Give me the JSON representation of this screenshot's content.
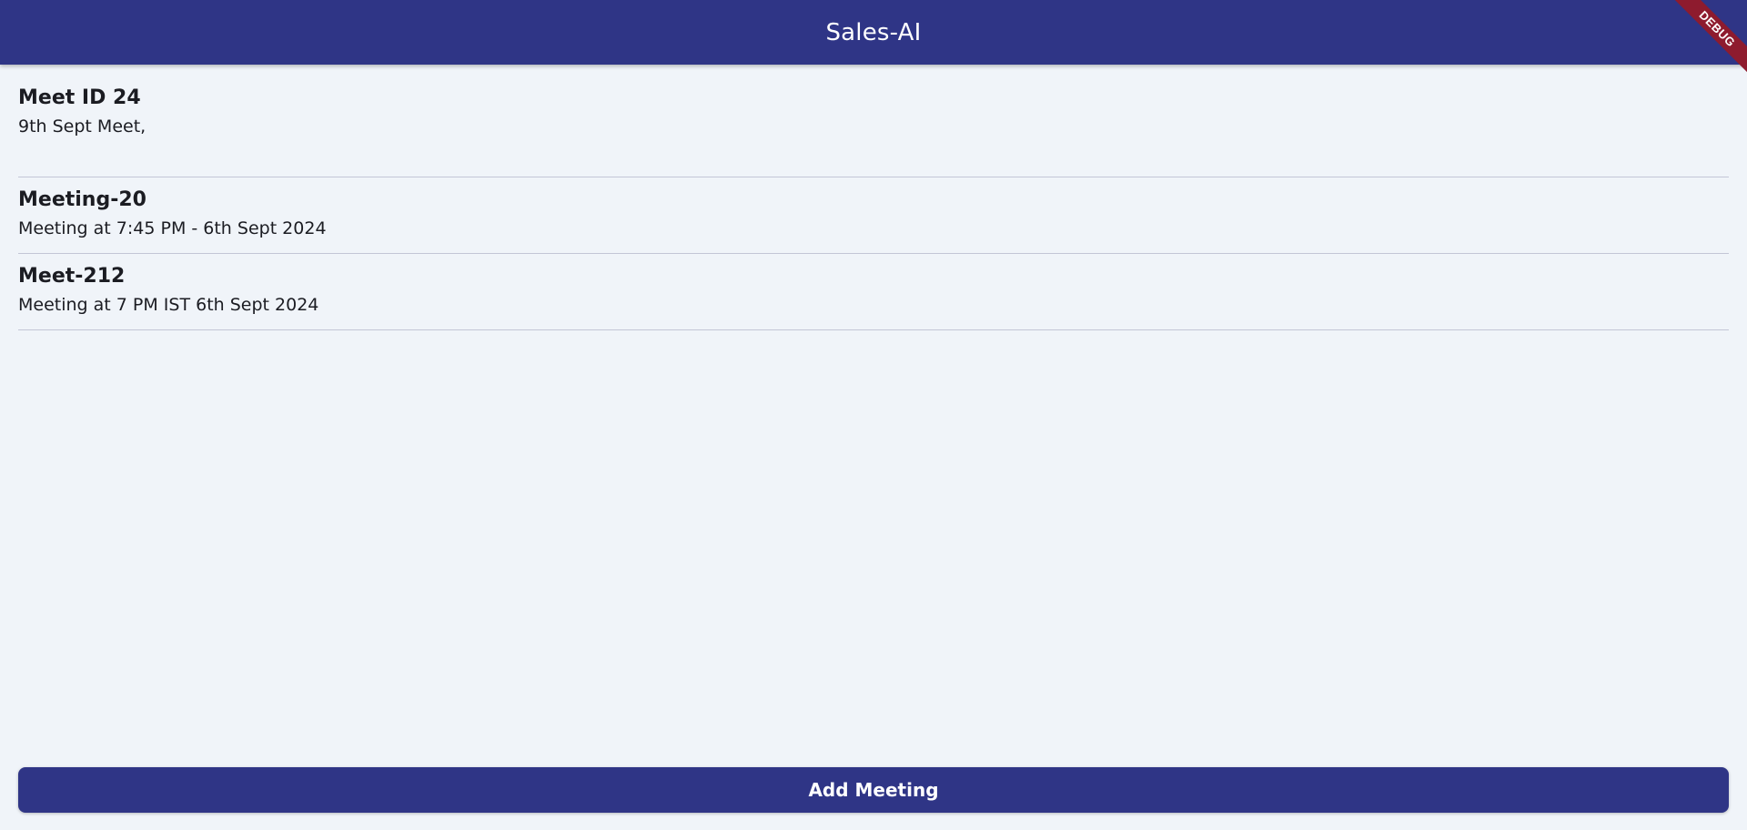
{
  "app": {
    "title": "Sales-AI",
    "debug_label": "DEBUG"
  },
  "meetings": [
    {
      "title": "Meet ID 24",
      "subtitle": "9th Sept Meet,"
    },
    {
      "title": "Meeting-20",
      "subtitle": "Meeting at 7:45 PM - 6th Sept 2024"
    },
    {
      "title": "Meet-212",
      "subtitle": "Meeting at 7 PM IST 6th Sept 2024"
    }
  ],
  "actions": {
    "add_meeting_label": "Add Meeting"
  },
  "colors": {
    "primary": "#2f3586",
    "background": "#f0f4f9",
    "debug": "#8e1b2e"
  }
}
